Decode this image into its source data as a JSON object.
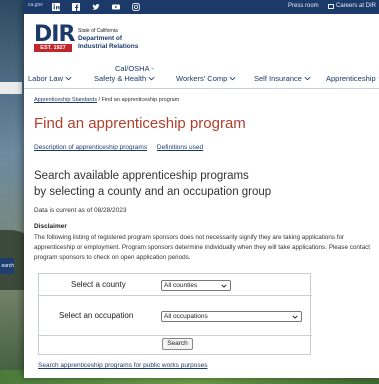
{
  "topbar": {
    "logo_text": "ca.gov",
    "social_icons": [
      "linkedin-icon",
      "facebook-icon",
      "twitter-icon",
      "youtube-icon",
      "instagram-icon"
    ],
    "press_room": "Press room",
    "careers": "Careers at DIR"
  },
  "brand": {
    "logo_letters": "DIR",
    "est": "EST. 1927",
    "state": "State of California",
    "dept_line1": "Department of",
    "dept_line2": "Industrial Relations"
  },
  "nav": {
    "items": [
      "Labor Law",
      "Safety & Health",
      "Workers' Comp",
      "Self Insurance",
      "Apprenticeship"
    ],
    "cal_osha_top": "Cal/OSHA -"
  },
  "breadcrumb": {
    "parent": "Apprenticeship Standards",
    "separator": "/",
    "current": "Find an apprenticeship program"
  },
  "page": {
    "title": "Find an apprenticeship program",
    "link1": "Description of apprenticeship programs",
    "link2": "Definitions used",
    "subtitle_line1": "Search available apprenticeship programs",
    "subtitle_line2": "by selecting a county and an occupation group",
    "as_of": "Data is current as of 08/28/2023",
    "disclaimer_heading": "Disclaimer",
    "disclaimer_text": "The following listing of registered program sponsors does not necessarily signify they are taking applications for apprenticeship or employment. Program sponsors determine individually when they will take applications. Please contact program sponsors to check on open application periods."
  },
  "form": {
    "county_label": "Select a county",
    "county_value": "All counties",
    "occupation_label": "Select an occupation",
    "occupation_value": "All occupations",
    "search_button": "Search"
  },
  "footer_link": "Search apprenticeship programs for public works purposes",
  "background": {
    "search_button_fragment": "earch"
  },
  "colors": {
    "topbar": "#1b3a6a",
    "title": "#b0402e",
    "link": "#1b3a6a",
    "est_badge": "#c0272d"
  }
}
